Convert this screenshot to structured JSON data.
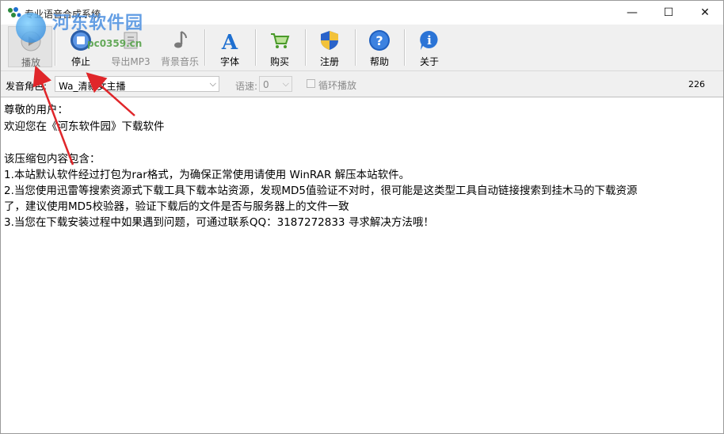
{
  "window": {
    "title": "专业语音合成系统",
    "controls": {
      "minimize": "—",
      "maximize": "☐",
      "close": "✕"
    }
  },
  "watermark": {
    "text": "河东软件园",
    "url": "pc0359.cn"
  },
  "toolbar": {
    "items": [
      {
        "label": "播放",
        "icon": "play-icon"
      },
      {
        "label": "停止",
        "icon": "stop-icon"
      },
      {
        "label": "导出MP3",
        "icon": "export-mp3-icon"
      },
      {
        "label": "背景音乐",
        "icon": "music-note-icon"
      },
      {
        "label": "字体",
        "icon": "font-icon"
      },
      {
        "label": "购买",
        "icon": "cart-icon"
      },
      {
        "label": "注册",
        "icon": "shield-icon"
      },
      {
        "label": "帮助",
        "icon": "help-icon"
      },
      {
        "label": "关于",
        "icon": "info-icon"
      }
    ]
  },
  "options": {
    "voice_label": "发音角色:",
    "voice_value": "Wa_清新女主播",
    "speed_label": "语速:",
    "speed_value": "0",
    "loop_label": "循环播放",
    "char_count": "226"
  },
  "content": {
    "lines": [
      "尊敬的用户：",
      "欢迎您在《河东软件园》下载软件",
      "",
      "该压缩包内容包含：",
      "1.本站默认软件经过打包为rar格式，为确保正常使用请使用 WinRAR 解压本站软件。",
      "2.当您使用迅雷等搜索资源式下载工具下载本站资源，发现MD5值验证不对时，很可能是这类型工具自动链接搜索到挂木马的下载资源",
      "了，建议使用MD5校验器，验证下载后的文件是否与服务器上的文件一致",
      "3.当您在下载安装过程中如果遇到问题，可通过联系QQ：3187272833 寻求解决方法哦！"
    ]
  },
  "colors": {
    "accent": "#1e6fd0",
    "annotation_arrow": "#e0262a"
  }
}
